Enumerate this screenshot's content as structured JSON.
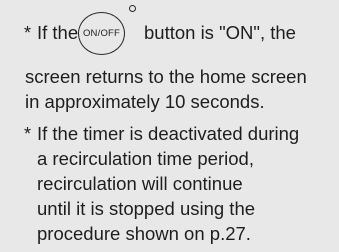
{
  "notes": [
    {
      "bullet": "*",
      "line1_pre": "If the",
      "button_label": "ON/OFF",
      "line1_post": "button is \"ON\", the",
      "line2": "screen returns to the home screen",
      "line3": "in approximately 10 seconds."
    },
    {
      "bullet": "*",
      "lines": [
        "If the timer is deactivated during",
        "a recirculation time period,",
        "recirculation will continue",
        "until it is stopped using the",
        "procedure shown on p.27."
      ]
    }
  ]
}
